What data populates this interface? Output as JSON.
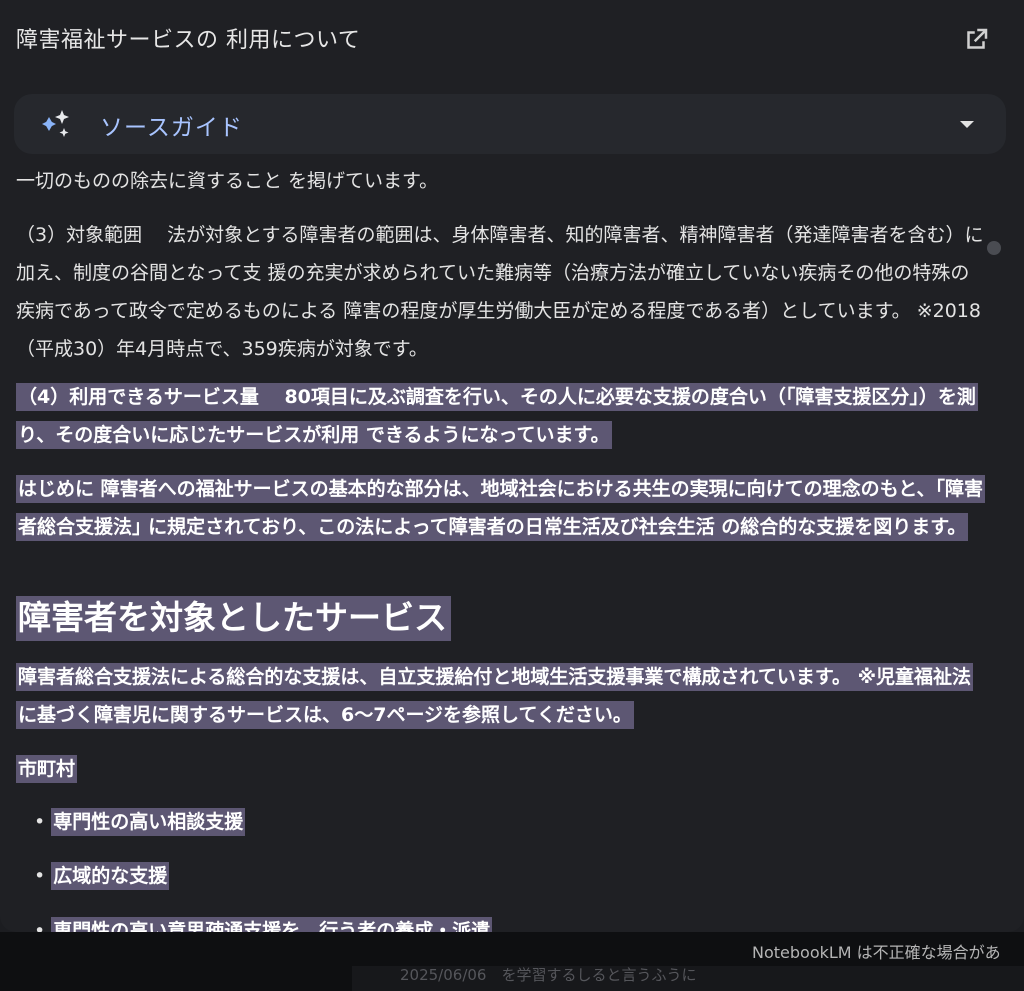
{
  "panel": {
    "title": "障害福祉サービスの 利用について",
    "open_icon": "open-in-new-icon"
  },
  "source_guide": {
    "label": "ソースガイド",
    "icon": "sparkle-icon",
    "caret_icon": "caret-down-icon",
    "accent_color": "#a8c4ff"
  },
  "content": {
    "p1": "一切のものの除去に資すること を掲げています。",
    "p2": "（3）対象範囲　 法が対象とする障害者の範囲は、身体障害者、知的障害者、精神障害者（発達障害者を含む）に加え、制度の谷間となって支 援の充実が求められていた難病等（治療方法が確立していない疾病その他の特殊の疾病であって政令で定めるものによる 障害の程度が厚生労働大臣が定める程度である者）としています。 ※2018（平成30）年4月時点で、359疾病が対象です。",
    "p3": "（4）利用できるサービス量　 80項目に及ぶ調査を行い、その人に必要な支援の度合い（｢障害支援区分｣）を測り、その度合いに応じたサービスが利用 できるようになっています。",
    "p4": "はじめに 障害者への福祉サービスの基本的な部分は、地域社会における共生の実現に向けての理念のもと、｢障害者総合支援法｣ に規定されており、この法によって障害者の日常生活及び社会生活 の総合的な支援を図ります。",
    "heading": "障害者を対象としたサービス",
    "p5": "障害者総合支援法による総合的な支援は、自立支援給付と地域生活支援事業で構成されています。 ※児童福祉法に基づく障害児に関するサービスは、6〜7ページを参照してください。",
    "subheading": "市町村",
    "bullets": [
      "専門性の高い相談支援",
      "広域的な支援",
      "専門性の高い意思疎通支援を　行う者の養成・派遣"
    ],
    "highlight_color": "#5d5773"
  },
  "footer": {
    "notice": "NotebookLM は不正確な場合があ",
    "faded_text": "2025/06/06　を学習するしると言うふうに"
  }
}
